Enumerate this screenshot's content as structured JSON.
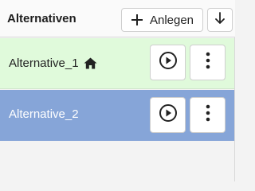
{
  "header": {
    "title": "Alternativen",
    "add_label": "Anlegen"
  },
  "alternatives": [
    {
      "name": "Alternative_1",
      "is_home": true,
      "state": "highlighted-green"
    },
    {
      "name": "Alternative_2",
      "is_home": false,
      "state": "selected"
    }
  ],
  "colors": {
    "row_highlight": "#e0fadb",
    "row_selected": "#86a5d8"
  },
  "icons": {
    "add": "plus-icon",
    "sort": "arrow-down-icon",
    "home": "home-icon",
    "run": "play-circle-icon",
    "menu": "more-vertical-icon"
  }
}
